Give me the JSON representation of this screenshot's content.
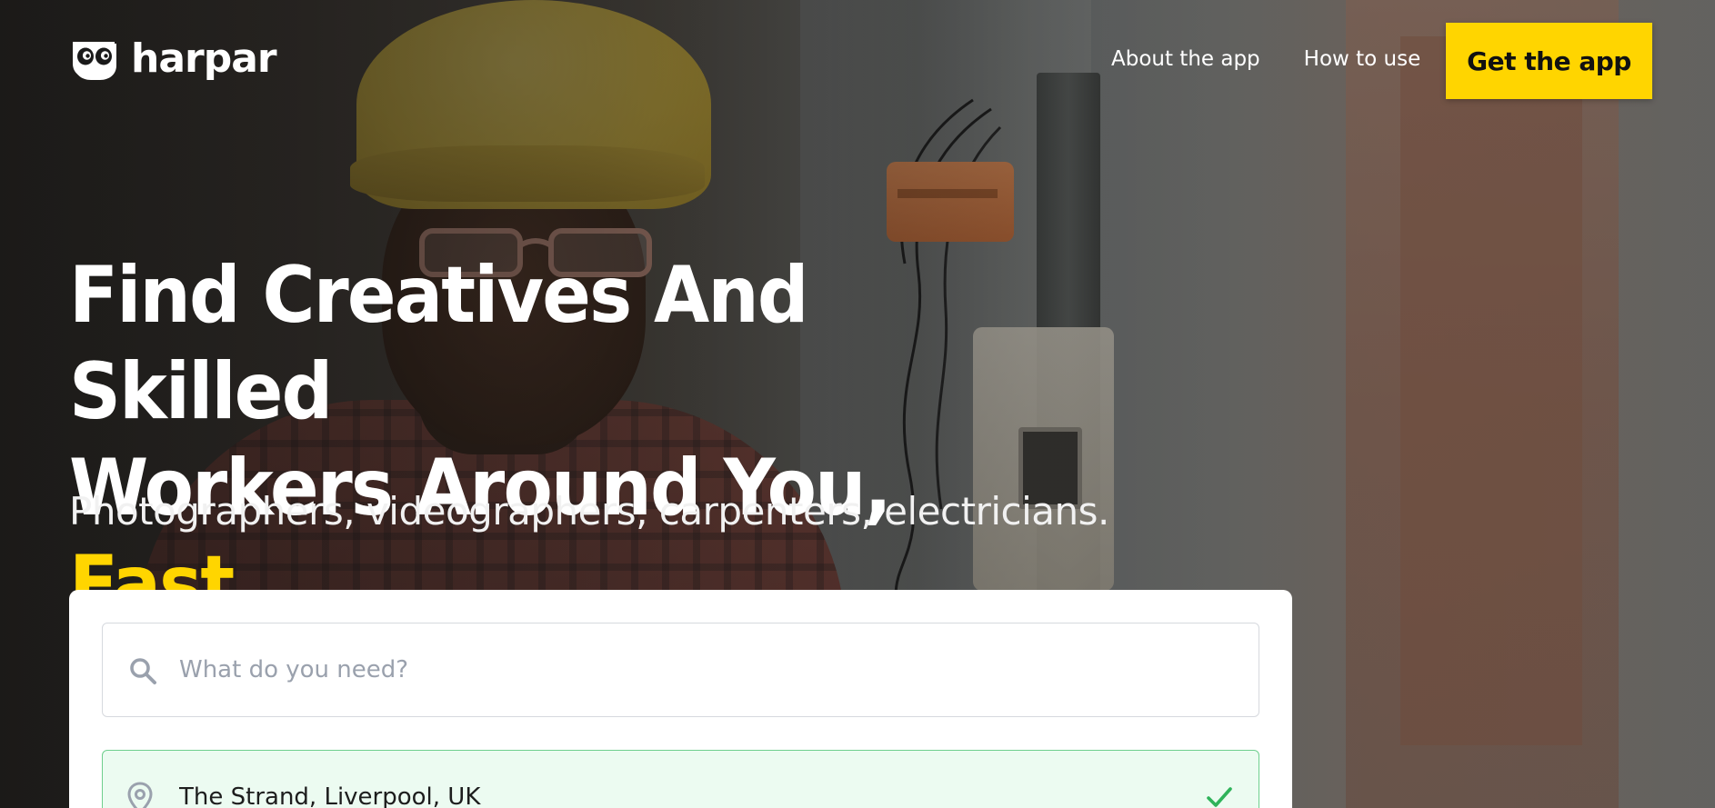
{
  "brand": {
    "name": "harpar",
    "logo_icon": "harpar-eyes-logo"
  },
  "nav": {
    "links": [
      {
        "label": "About the app"
      },
      {
        "label": "How to use"
      }
    ],
    "cta_label": "Get the app"
  },
  "hero": {
    "headline_line1": "Find Creatives And Skilled",
    "headline_line2_prefix": "Workers Around You, ",
    "headline_accent": "Fast",
    "subheadline": "Photographers, videographers, carpenters, electricians."
  },
  "search": {
    "placeholder": "What do you need?",
    "value": "",
    "icon": "search-icon"
  },
  "location": {
    "value": "The Strand, Liverpool, UK",
    "icon": "map-pin-icon",
    "status_icon": "check-icon"
  },
  "colors": {
    "accent": "#ffd500",
    "location_border": "#6fcf8e",
    "location_bg": "#ecfbf1",
    "check": "#2fb35a"
  }
}
